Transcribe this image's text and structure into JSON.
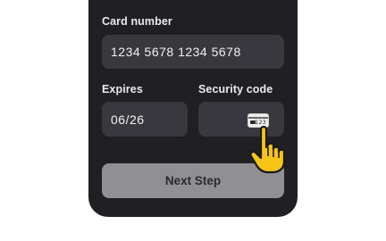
{
  "form": {
    "card_number_label": "Card number",
    "card_number_value": "1234 5678 1234 5678",
    "expires_label": "Expires",
    "expires_value": "06/26",
    "security_code_label": "Security code",
    "security_code_value": "",
    "card_icon": "card-back-icon",
    "card_icon_text": "123",
    "next_button_label": "Next Step"
  },
  "cursor": {
    "icon": "pointer-hand-icon",
    "color": "#f5c518"
  },
  "colors": {
    "panel": "#1f1f24",
    "field": "#38383e",
    "button": "#8f8f94"
  }
}
